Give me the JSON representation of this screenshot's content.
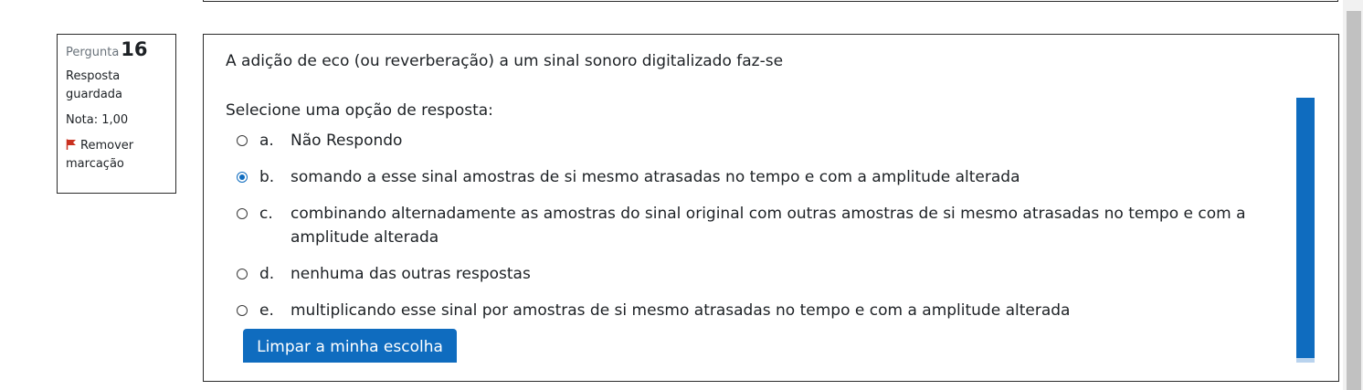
{
  "info": {
    "question_label": "Pergunta",
    "question_number": "16",
    "state": "Resposta guardada",
    "grade": "Nota: 1,00",
    "flag_label": "Remover marcação"
  },
  "question": {
    "text": "A adição de eco (ou reverberação) a um sinal sonoro digitalizado faz-se",
    "prompt": "Selecione uma opção de resposta:",
    "answers": [
      {
        "letter": "a.",
        "text": "Não Respondo",
        "selected": false
      },
      {
        "letter": "b.",
        "text": "somando a esse sinal amostras de si mesmo atrasadas no tempo e com a amplitude alterada",
        "selected": true
      },
      {
        "letter": "c.",
        "text": "combinando alternadamente as amostras do sinal original com outras amostras de si mesmo atrasadas no tempo e com a amplitude alterada",
        "selected": false
      },
      {
        "letter": "d.",
        "text": "nenhuma das outras respostas",
        "selected": false
      },
      {
        "letter": "e.",
        "text": "multiplicando esse sinal por amostras de si mesmo atrasadas no tempo e com a amplitude alterada",
        "selected": false
      }
    ],
    "clear_label": "Limpar a minha escolha"
  },
  "colors": {
    "accent": "#0f6cbf",
    "flag": "#ca3120"
  }
}
